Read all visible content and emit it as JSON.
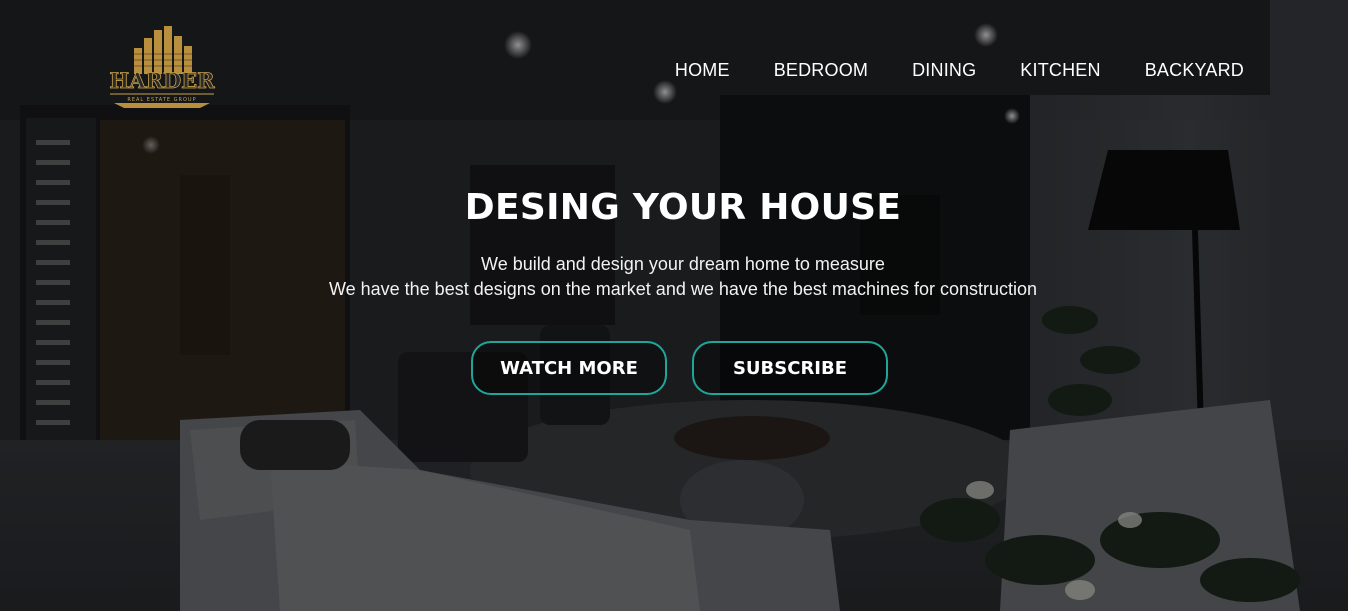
{
  "brand": {
    "name": "HARDER",
    "sub": "REAL ESTATE GROUP",
    "gold": "#c9a24a"
  },
  "nav": {
    "items": [
      {
        "label": "HOME",
        "name": "nav-home"
      },
      {
        "label": "BEDROOM",
        "name": "nav-bedroom"
      },
      {
        "label": "DINING",
        "name": "nav-dining"
      },
      {
        "label": "KITCHEN",
        "name": "nav-kitchen"
      },
      {
        "label": "BACKYARD",
        "name": "nav-backyard"
      }
    ]
  },
  "hero": {
    "title": "DESING YOUR HOUSE",
    "line1": "We build and design your dream home to measure",
    "line2": "We have the best designs on the market and we have the best machines for construction",
    "watch_label": "WATCH MORE",
    "subscribe_label": "SUBSCRIBE",
    "accent": "#1fa59a"
  }
}
